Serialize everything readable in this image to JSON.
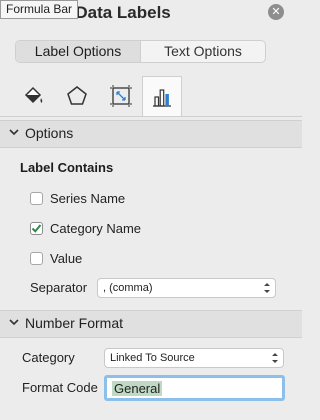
{
  "tooltip": "Formula Bar",
  "panel": {
    "title": "Format Data Labels"
  },
  "segments": {
    "label_options": "Label Options",
    "text_options": "Text Options"
  },
  "icon_tabs": [
    "paint-bucket-icon",
    "pentagon-icon",
    "size-properties-icon",
    "bar-chart-icon"
  ],
  "sections": {
    "options": "Options",
    "number_format": "Number Format"
  },
  "label_contains": {
    "title": "Label Contains",
    "items": [
      {
        "label": "Series Name",
        "checked": false
      },
      {
        "label": "Category Name",
        "checked": true
      },
      {
        "label": "Value",
        "checked": false
      }
    ]
  },
  "separator": {
    "label": "Separator",
    "value": ", (comma)"
  },
  "number_format": {
    "category_label": "Category",
    "category_value": "Linked To Source",
    "format_code_label": "Format Code",
    "format_code_value": "General"
  },
  "colors": {
    "check_accent": "#2c8a4a",
    "focus_ring": "#8cbfe9"
  }
}
